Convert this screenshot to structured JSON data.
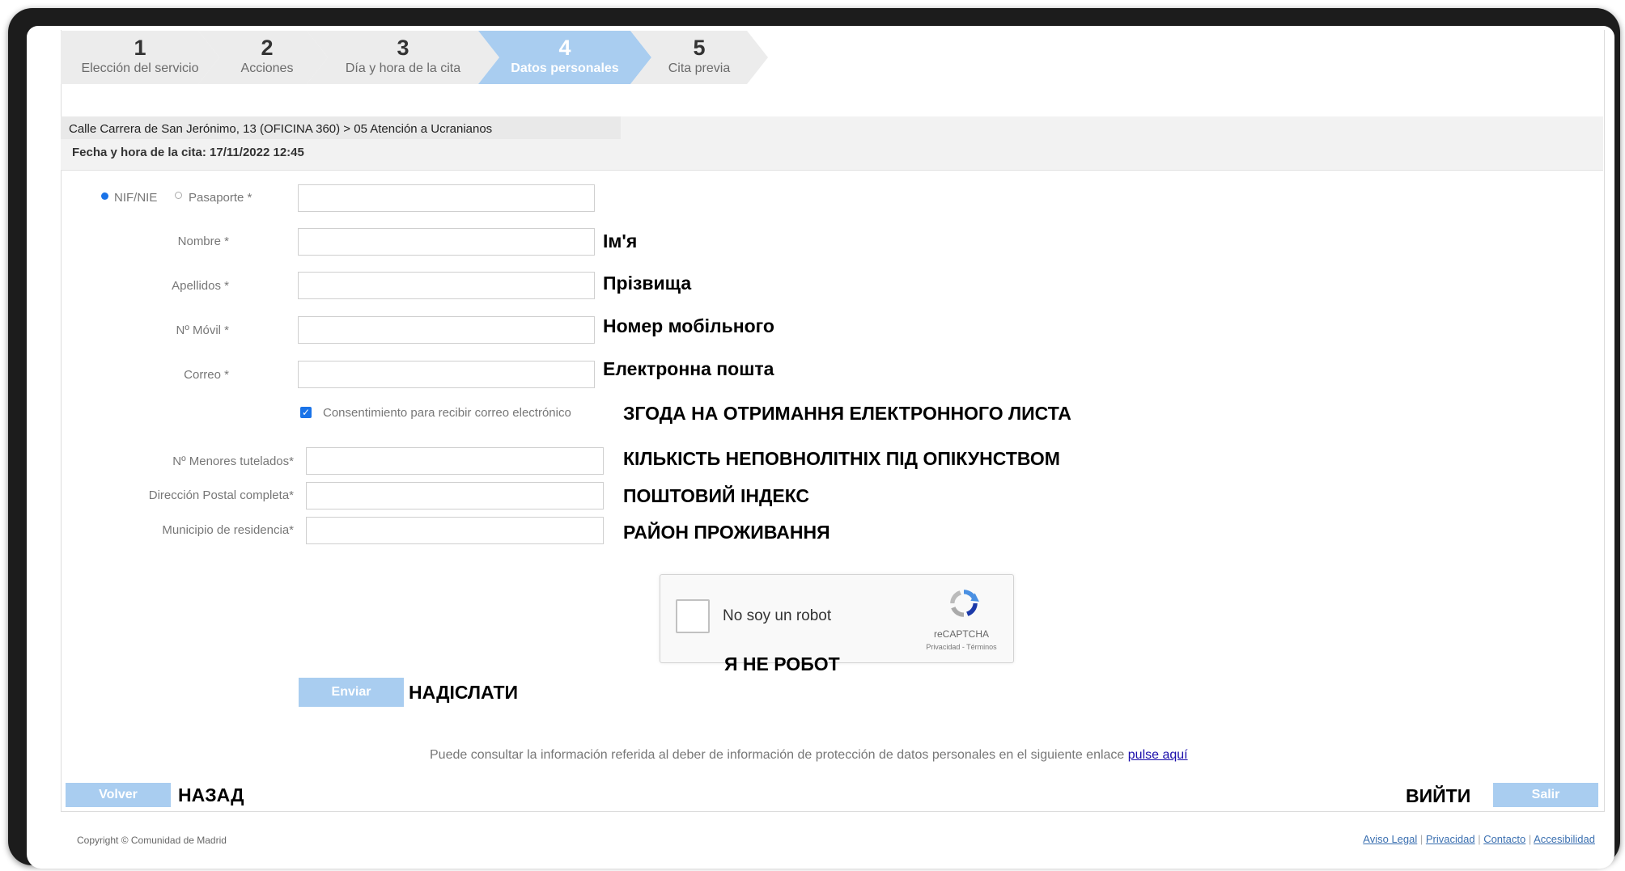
{
  "steps": [
    {
      "num": "1",
      "label": "Elección del servicio"
    },
    {
      "num": "2",
      "label": "Acciones"
    },
    {
      "num": "3",
      "label": "Día y hora de la cita"
    },
    {
      "num": "4",
      "label": "Datos personales"
    },
    {
      "num": "5",
      "label": "Cita previa"
    }
  ],
  "header": {
    "location": "Calle Carrera de San Jerónimo, 13 (OFICINA 360) > 05 Atención a Ucranianos",
    "datetime": "Fecha y hora de la cita: 17/11/2022 12:45"
  },
  "form": {
    "id_type": {
      "nif_label": "NIF/NIE",
      "passport_label": "Pasaporte *"
    },
    "nombre": {
      "label": "Nombre *",
      "annotation": "Ім'я"
    },
    "apellidos": {
      "label": "Apellidos *",
      "annotation": "Прізвища"
    },
    "movil": {
      "label": "Nº Móvil *",
      "annotation": "Номер мобільного"
    },
    "correo": {
      "label": "Correo *",
      "annotation": "Електронна пошта"
    },
    "consent": {
      "label": "Consentimiento para recibir correo electrónico",
      "annotation": "ЗГОДА НА ОТРИМАННЯ ЕЛЕКТРОННОГО ЛИСТА"
    },
    "menores": {
      "label": "Nº Menores tutelados*",
      "annotation": "КІЛЬКІСТЬ НЕПОВНОЛІТНІХ ПІД ОПІКУНСТВОМ"
    },
    "direccion": {
      "label": "Dirección Postal completa*",
      "annotation": "ПОШТОВИЙ ІНДЕКС"
    },
    "municipio": {
      "label": "Municipio de residencia*",
      "annotation": "РАЙОН ПРОЖИВАННЯ"
    }
  },
  "recaptcha": {
    "text": "No soy un robot",
    "annotation": "Я НЕ РОБОТ",
    "brand": "reCAPTCHA",
    "links": "Privacidad - Términos"
  },
  "submit": {
    "label": "Enviar",
    "annotation": "НАДІСЛАТИ"
  },
  "info": {
    "text": "Puede consultar la información referida al deber de información de protección de datos personales en el siguiente enlace ",
    "link": "pulse aquí"
  },
  "nav": {
    "back_label": "Volver",
    "back_annotation": "НАЗАД",
    "exit_label": "Salir",
    "exit_annotation": "ВИЙТИ"
  },
  "footer": {
    "copyright": "Copyright © Comunidad de Madrid",
    "links": [
      "Aviso Legal",
      "Privacidad",
      "Contacto",
      "Accesibilidad"
    ]
  },
  "colors": {
    "accent": "#a9cdf0",
    "link": "#1a0dab",
    "checkbox": "#1a73e8"
  }
}
